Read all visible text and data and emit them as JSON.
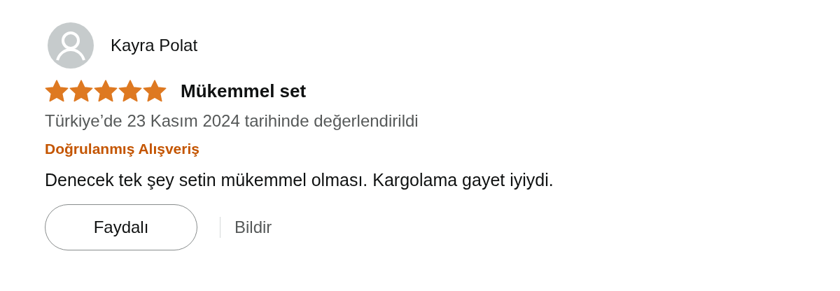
{
  "review": {
    "reviewer": "Kayra Polat",
    "stars": 5,
    "title": "Mükemmel set",
    "date": "Türkiye’de 23 Kasım 2024 tarihinde değerlendirildi",
    "badge": "Doğrulanmış Alışveriş",
    "body": "Denecek tek şey setin mükemmel olması. Kargolama gayet iyiydi.",
    "helpful_button": "Faydalı",
    "report_link": "Bildir"
  }
}
